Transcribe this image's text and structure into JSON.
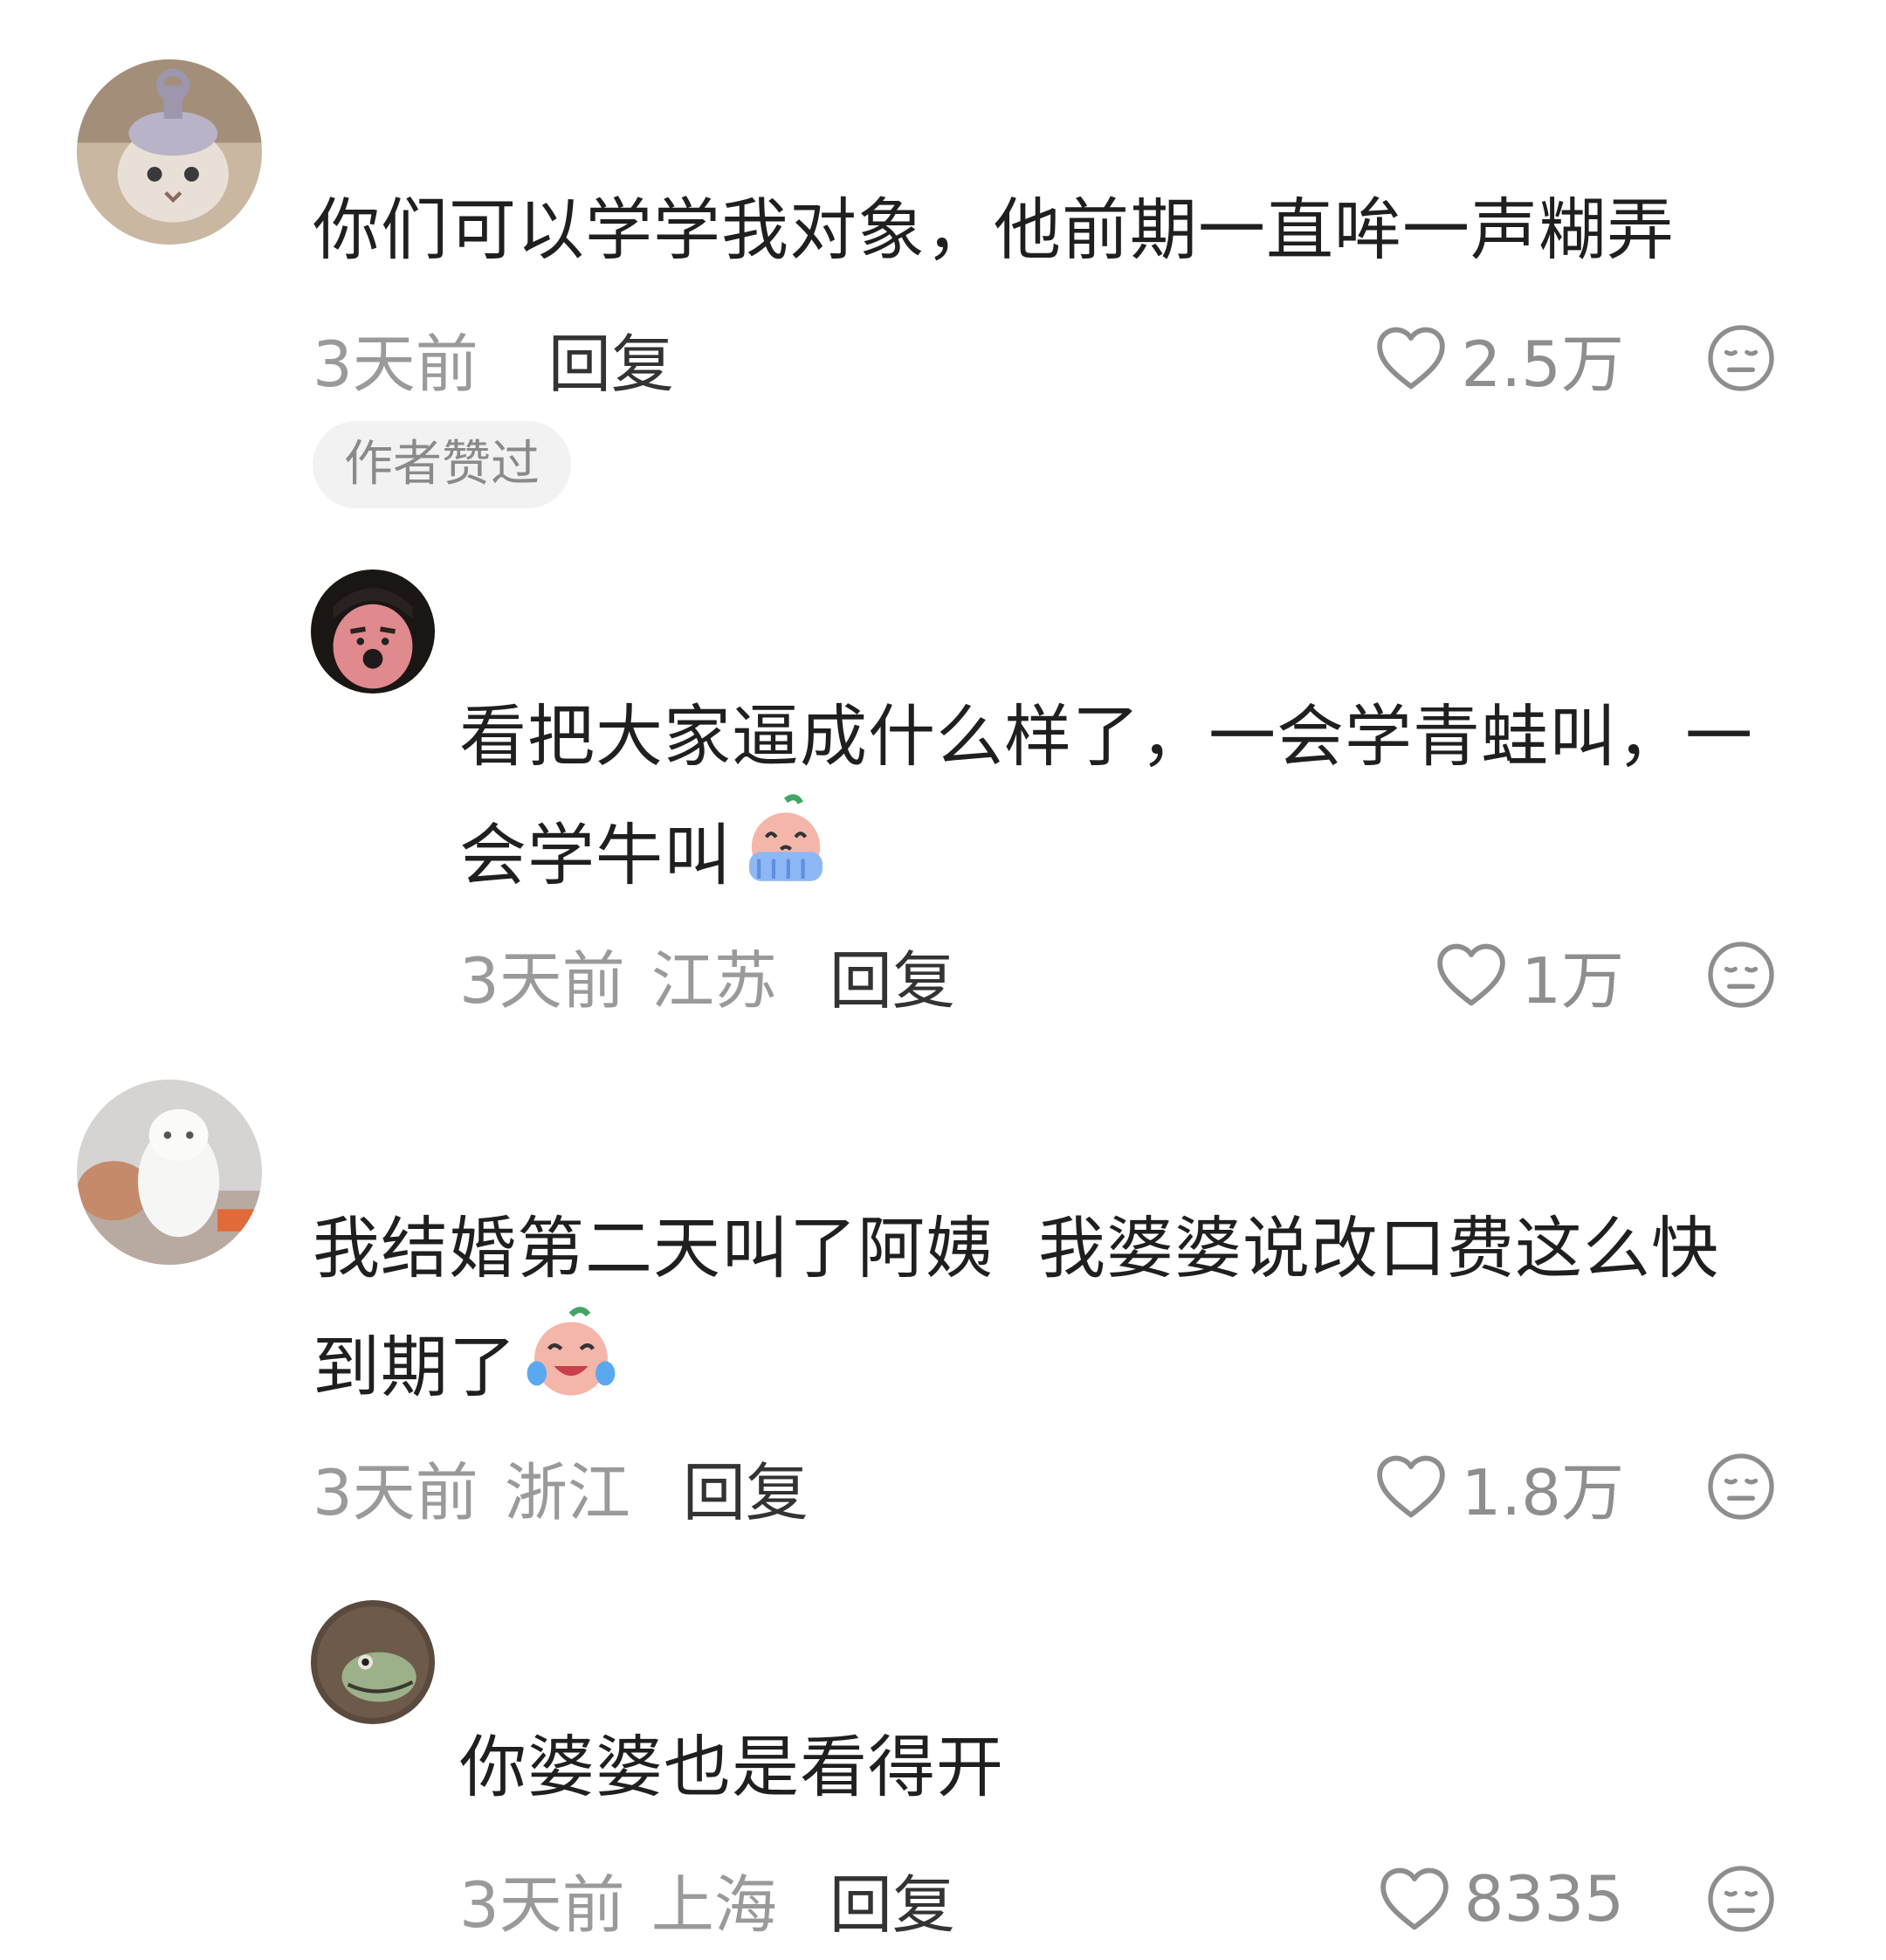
{
  "comments": [
    {
      "text": "你们可以学学我对象，他前期一直哞一声糊弄",
      "time": "3天前",
      "location": "",
      "reply": "回复",
      "likes": "2.5万",
      "badge": "作者赞过"
    },
    {
      "text_line1": "看把大家逼成什么样了，一会学青蛙叫，一",
      "text_line2": "会学牛叫",
      "time": "3天前",
      "location": "江苏",
      "reply": "回复",
      "likes": "1万",
      "emoji": "crying-emoji"
    },
    {
      "text_line1": "我结婚第二天叫了阿姨  我婆婆说改口费这么快",
      "text_line2": "到期了",
      "time": "3天前",
      "location": "浙江",
      "reply": "回复",
      "likes": "1.8万",
      "emoji": "laugh-cry-emoji"
    },
    {
      "text": "你婆婆也是看得开",
      "time": "3天前",
      "location": "上海",
      "reply": "回复",
      "likes": "8335"
    }
  ],
  "icons": {
    "like": "heart-outline-icon",
    "dislike": "meh-face-icon"
  },
  "colors": {
    "text": "#1f1f1f",
    "meta": "#9a9a9a",
    "reply": "#333333",
    "badge_bg": "#f2f2f2"
  }
}
